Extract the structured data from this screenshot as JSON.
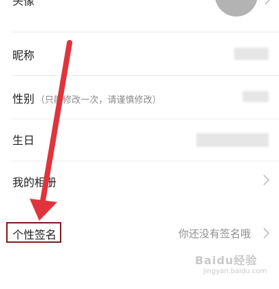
{
  "rows": {
    "avatar": {
      "label": "头像"
    },
    "nickname": {
      "label": "昵称"
    },
    "gender": {
      "label": "性别",
      "hint": "（只能修改一次，请谨慎修改）"
    },
    "birthday": {
      "label": "生日"
    },
    "album": {
      "label": "我的相册"
    },
    "signature": {
      "label": "个性签名",
      "value": "你还没有签名哦"
    }
  },
  "watermark": {
    "line1": "Baidu经验",
    "line2": "jingyan.baidu.com"
  },
  "colors": {
    "arrow": "#e0333c",
    "highlight_border": "#7a1b1b",
    "text": "#1f1f1f",
    "muted": "#8f8f8f"
  }
}
